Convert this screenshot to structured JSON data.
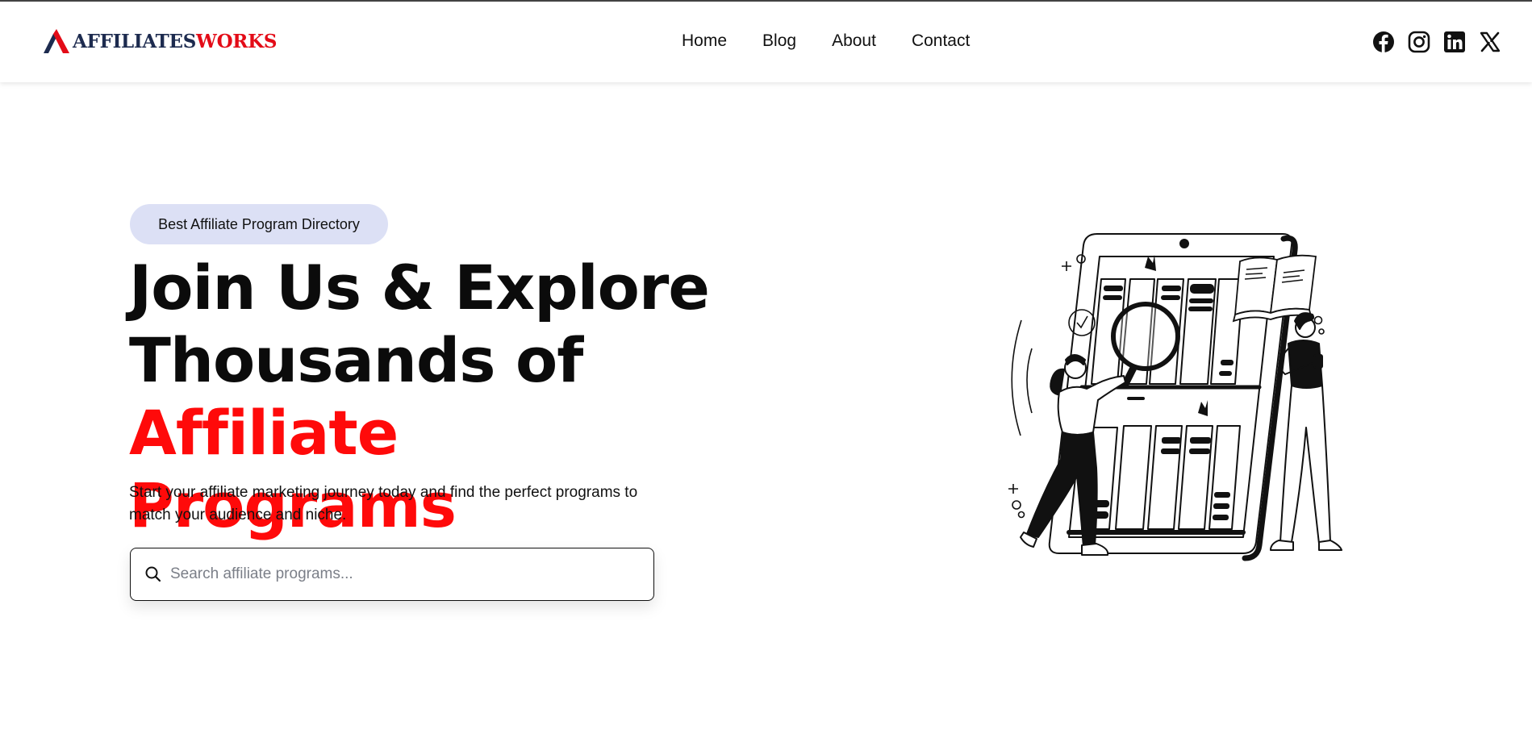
{
  "brand": {
    "part1": "AFFILIATES",
    "part2": "WORKS",
    "color_primary": "#1d2b4f",
    "color_accent": "#e30b17"
  },
  "nav": {
    "items": [
      "Home",
      "Blog",
      "About",
      "Contact"
    ]
  },
  "social": {
    "icons": [
      "facebook-icon",
      "instagram-icon",
      "linkedin-icon",
      "x-icon"
    ]
  },
  "hero": {
    "badge": "Best Affiliate Program Directory",
    "title_line1": "Join Us & Explore",
    "title_line2_dark": "Thousands of ",
    "title_line2_red": "Affiliate",
    "title_line3_red": "Programs",
    "lead": "Start your affiliate marketing journey today and find the perfect programs to match your audience and niche.",
    "accent_color": "#ff0a0a",
    "badge_bg": "#dce0f5"
  },
  "search": {
    "placeholder": "Search affiliate programs...",
    "value": ""
  },
  "illustration": {
    "icon": "people-browsing-phone-shelves-illustration"
  }
}
